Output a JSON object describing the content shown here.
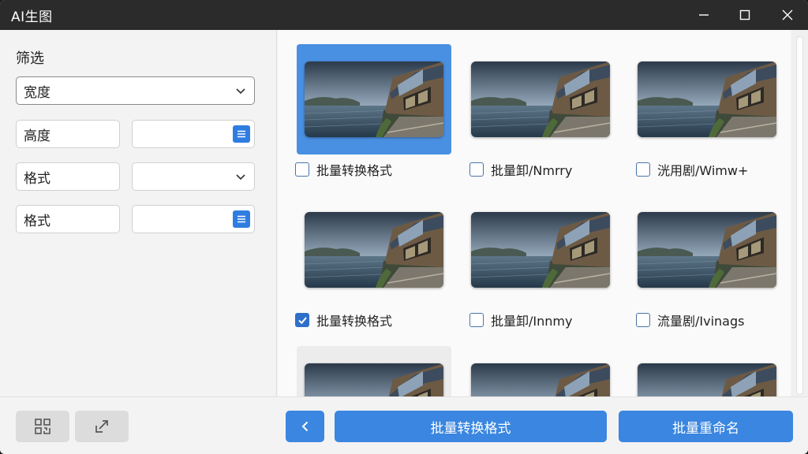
{
  "window": {
    "title": "AI生图"
  },
  "sidebar": {
    "title": "筛选",
    "width_select": "宽度",
    "height_label": "高度",
    "format_label_1": "格式",
    "format_label_2": "格式"
  },
  "gallery": {
    "items": [
      {
        "caption": "批量转换格式",
        "checked": false,
        "selected": true
      },
      {
        "caption": "批量卸/Nmrry",
        "checked": false,
        "selected": false
      },
      {
        "caption": "洸用剧/Wimw+",
        "checked": false,
        "selected": false
      },
      {
        "caption": "批量转换格式",
        "checked": true,
        "selected": false
      },
      {
        "caption": "批量卸/Innmy",
        "checked": false,
        "selected": false
      },
      {
        "caption": "流量剧/Ivinags",
        "checked": false,
        "selected": false
      }
    ]
  },
  "footer": {
    "convert_label": "批量转换格式",
    "rename_label": "批量重命名"
  },
  "icons": {
    "minimize": "minimize-icon",
    "maximize": "maximize-icon",
    "close": "close-icon",
    "qr": "qr-code-icon",
    "expand": "expand-arrow-icon",
    "back": "chevron-left-icon"
  },
  "colors": {
    "accent": "#3a86e0",
    "selected": "#4a90e2",
    "titlebar": "#2b2b2b"
  }
}
